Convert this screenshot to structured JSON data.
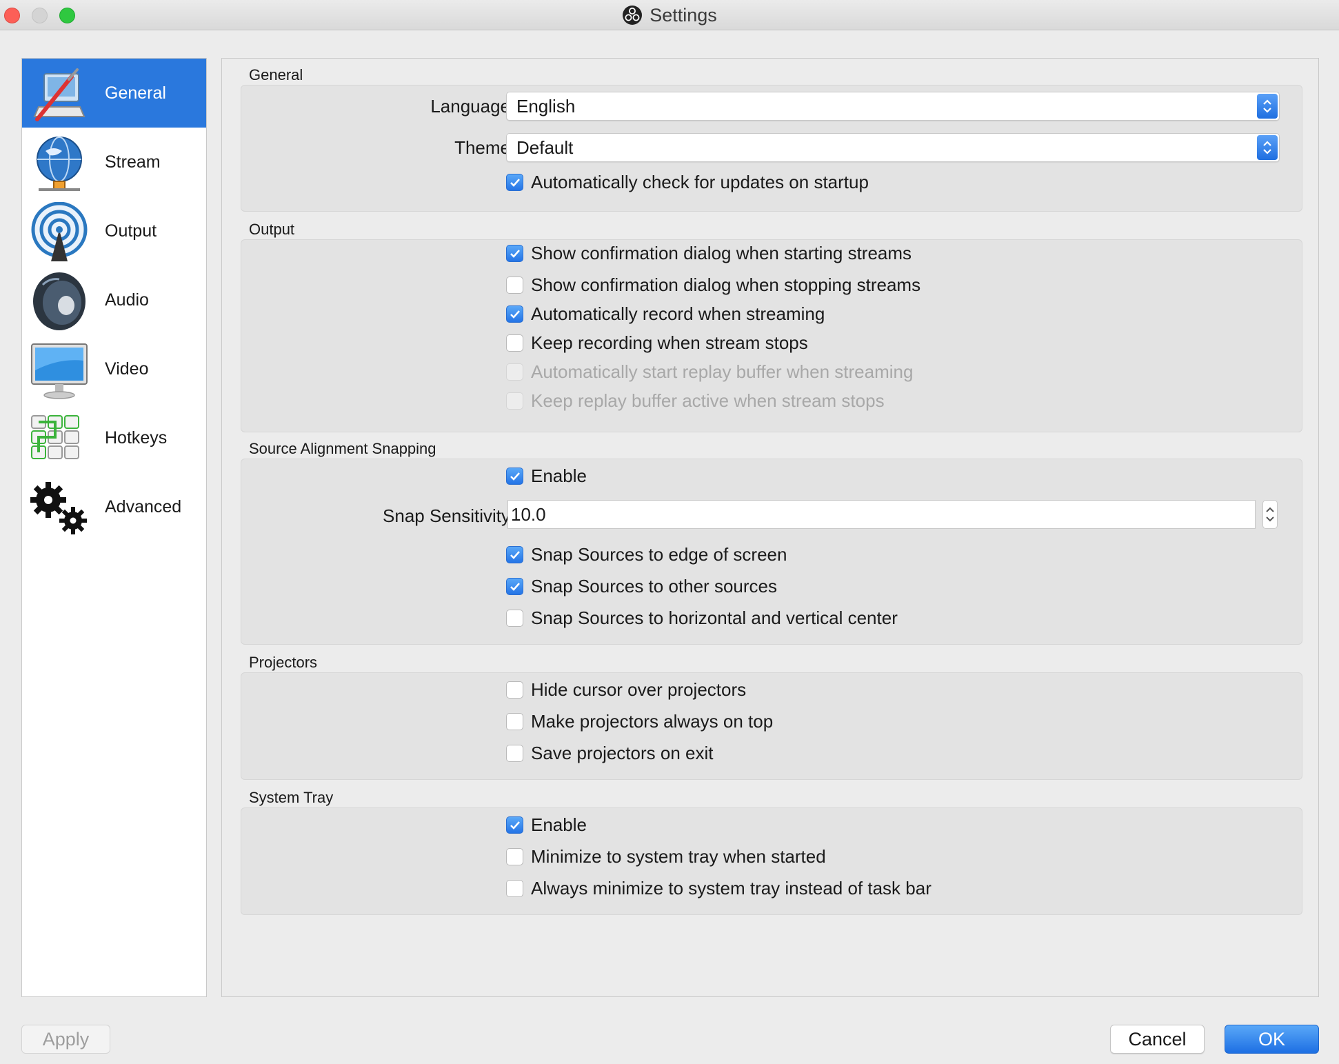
{
  "window": {
    "title": "Settings"
  },
  "sidebar": {
    "items": [
      {
        "label": "General",
        "icon": "general-icon",
        "active": true
      },
      {
        "label": "Stream",
        "icon": "globe-icon"
      },
      {
        "label": "Output",
        "icon": "broadcast-icon"
      },
      {
        "label": "Audio",
        "icon": "speaker-icon"
      },
      {
        "label": "Video",
        "icon": "monitor-icon"
      },
      {
        "label": "Hotkeys",
        "icon": "keyboard-icon"
      },
      {
        "label": "Advanced",
        "icon": "gears-icon"
      }
    ]
  },
  "general": {
    "title": "General",
    "language_label": "Language",
    "language_value": "English",
    "theme_label": "Theme",
    "theme_value": "Default",
    "check_updates": {
      "label": "Automatically check for updates on startup",
      "checked": true
    }
  },
  "output": {
    "title": "Output",
    "options": [
      {
        "label": "Show confirmation dialog when starting streams",
        "checked": true,
        "enabled": true
      },
      {
        "label": "Show confirmation dialog when stopping streams",
        "checked": false,
        "enabled": true
      },
      {
        "label": "Automatically record when streaming",
        "checked": true,
        "enabled": true
      },
      {
        "label": "Keep recording when stream stops",
        "checked": false,
        "enabled": true
      },
      {
        "label": "Automatically start replay buffer when streaming",
        "checked": false,
        "enabled": false
      },
      {
        "label": "Keep replay buffer active when stream stops",
        "checked": false,
        "enabled": false
      }
    ]
  },
  "snapping": {
    "title": "Source Alignment Snapping",
    "enable": {
      "label": "Enable",
      "checked": true
    },
    "sensitivity_label": "Snap Sensitivity",
    "sensitivity_value": "10.0",
    "options": [
      {
        "label": "Snap Sources to edge of screen",
        "checked": true
      },
      {
        "label": "Snap Sources to other sources",
        "checked": true
      },
      {
        "label": "Snap Sources to horizontal and vertical center",
        "checked": false
      }
    ]
  },
  "projectors": {
    "title": "Projectors",
    "options": [
      {
        "label": "Hide cursor over projectors",
        "checked": false
      },
      {
        "label": "Make projectors always on top",
        "checked": false
      },
      {
        "label": "Save projectors on exit",
        "checked": false
      }
    ]
  },
  "system_tray": {
    "title": "System Tray",
    "options": [
      {
        "label": "Enable",
        "checked": true
      },
      {
        "label": "Minimize to system tray when started",
        "checked": false
      },
      {
        "label": "Always minimize to system tray instead of task bar",
        "checked": false
      }
    ]
  },
  "buttons": {
    "apply": "Apply",
    "cancel": "Cancel",
    "ok": "OK"
  },
  "colors": {
    "accent": "#2a78dd",
    "checkbox_checked": "#2474e6",
    "close": "#fc5f57",
    "zoom": "#2fc840"
  }
}
